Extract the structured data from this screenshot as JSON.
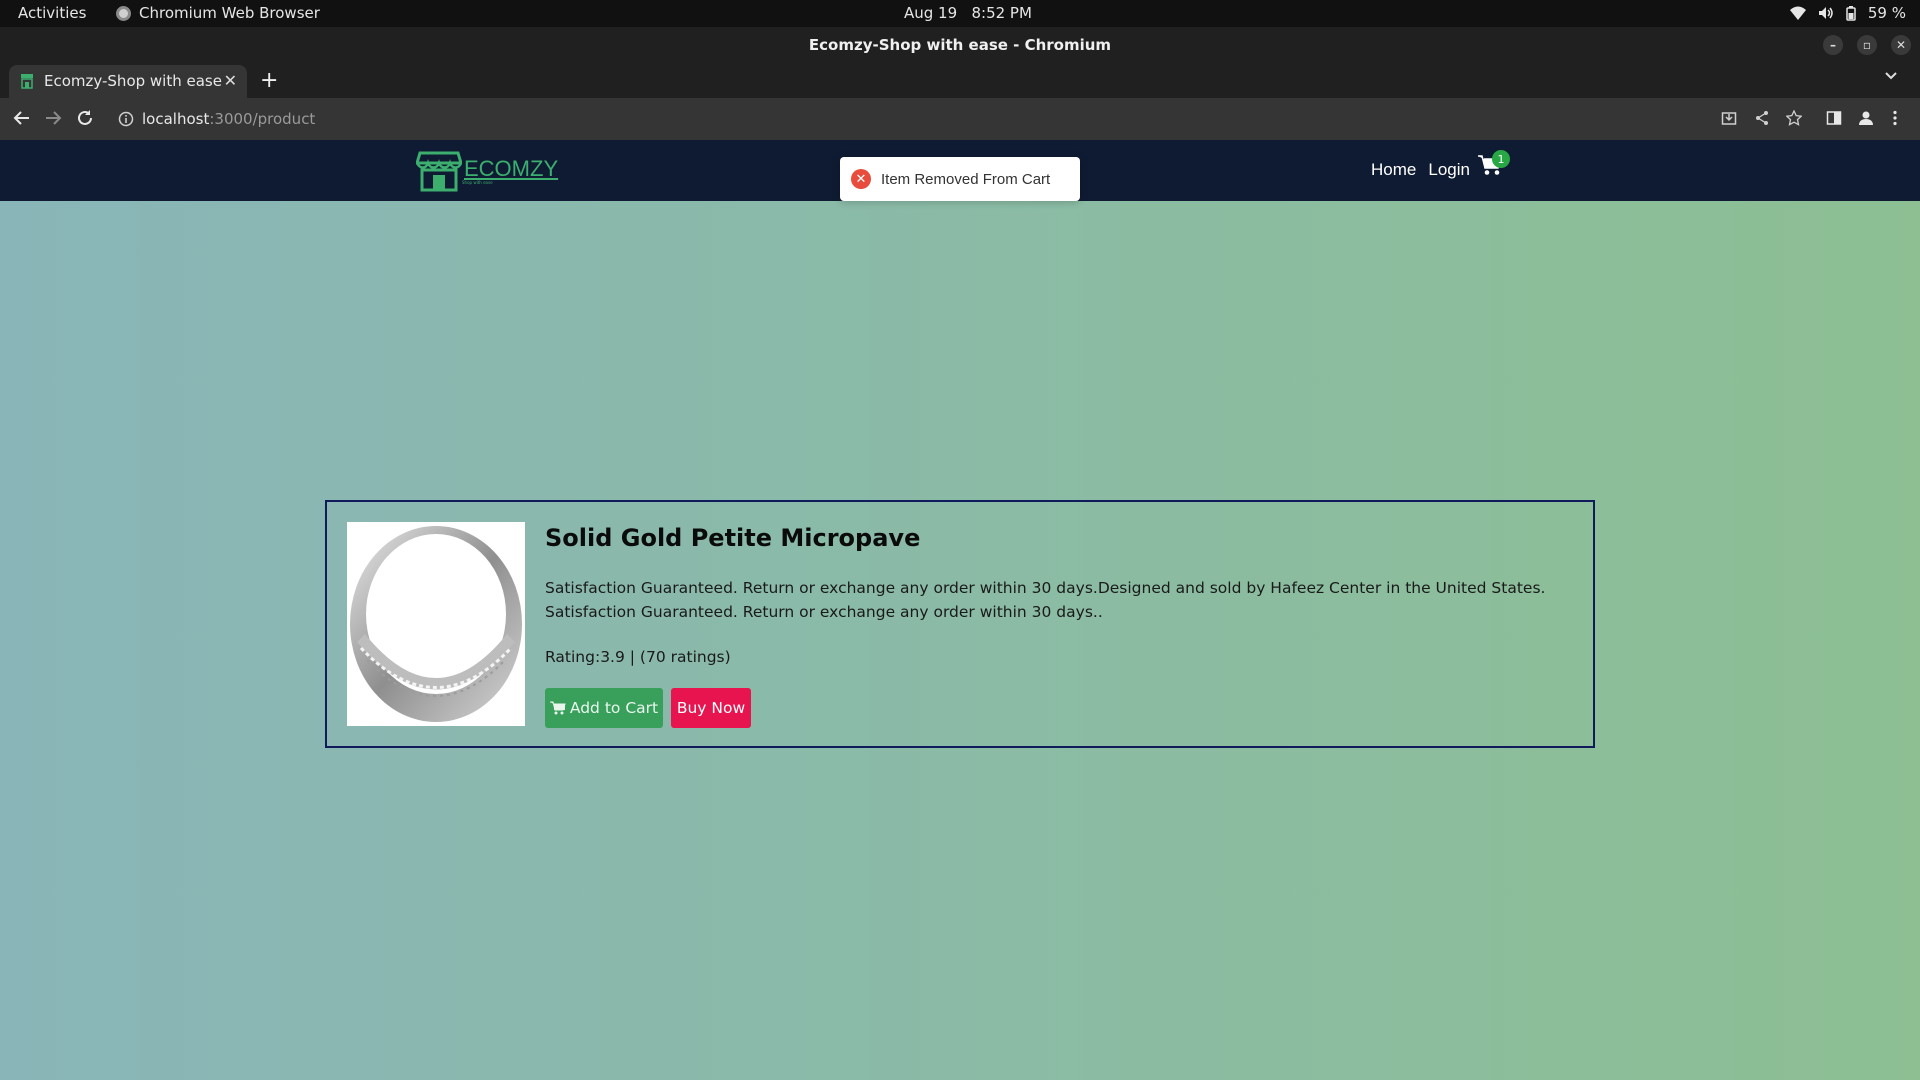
{
  "system_bar": {
    "activities": "Activities",
    "app_name": "Chromium Web Browser",
    "date": "Aug 19",
    "time": "8:52 PM",
    "battery": "59 %"
  },
  "window": {
    "title": "Ecomzy-Shop with ease - Chromium"
  },
  "tabs": [
    {
      "title": "Ecomzy-Shop with ease",
      "active": true
    }
  ],
  "address_bar": {
    "host": "localhost",
    "path": ":3000/product"
  },
  "site": {
    "brand": "ECOMZY",
    "brand_tagline": "Shop with ease",
    "nav": {
      "home": "Home",
      "login": "Login"
    },
    "cart_count": "1",
    "accent_color": "#3cae6e"
  },
  "toast": {
    "message": "Item Removed From Cart",
    "status": "error"
  },
  "product": {
    "name": "Solid Gold Petite Micropave",
    "description": "Satisfaction Guaranteed. Return or exchange any order within 30 days.Designed and sold by Hafeez Center in the United States. Satisfaction Guaranteed. Return or exchange any order within 30 days..",
    "rating_text": "Rating:3.9 | (70 ratings)",
    "add_to_cart": "Add to Cart",
    "buy_now": "Buy Now"
  }
}
